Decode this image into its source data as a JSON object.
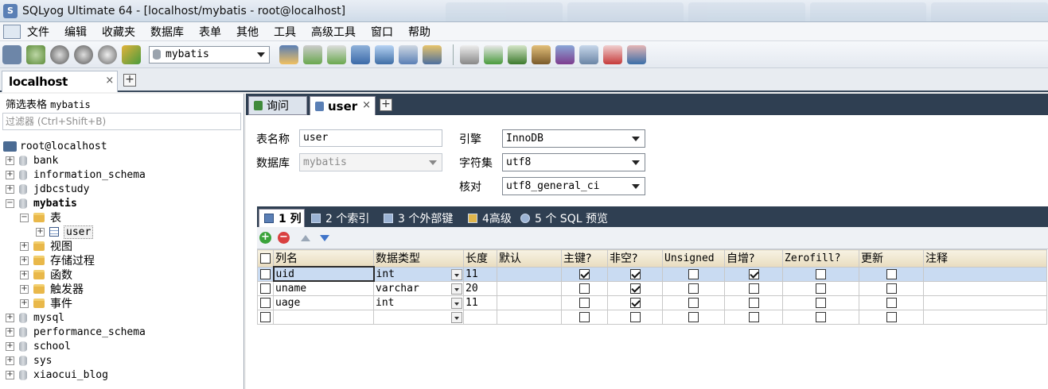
{
  "window": {
    "title": "SQLyog Ultimate 64 - [localhost/mybatis - root@localhost]"
  },
  "menu": [
    "文件",
    "编辑",
    "收藏夹",
    "数据库",
    "表单",
    "其他",
    "工具",
    "高级工具",
    "窗口",
    "帮助"
  ],
  "toolbar": {
    "database_select": "mybatis"
  },
  "connection_tab": {
    "label": "localhost",
    "close": "×"
  },
  "sidebar": {
    "filter_label": "筛选表格",
    "filter_db": "mybatis",
    "filter_placeholder": "过滤器 (Ctrl+Shift+B)",
    "root": "root@localhost",
    "databases": [
      "bank",
      "information_schema",
      "jdbcstudy",
      "mybatis",
      "mysql",
      "performance_schema",
      "school",
      "sys",
      "xiaocui_blog"
    ],
    "mybatis_children": {
      "tables": "表",
      "table_user": "user",
      "views": "视图",
      "procedures": "存储过程",
      "functions": "函数",
      "triggers": "触发器",
      "events": "事件"
    }
  },
  "query_tabs": [
    {
      "label": "询问"
    },
    {
      "label": "user",
      "close": "×"
    }
  ],
  "form": {
    "table_name_label": "表名称",
    "table_name": "user",
    "database_label": "数据库",
    "database": "mybatis",
    "engine_label": "引擎",
    "engine": "InnoDB",
    "charset_label": "字符集",
    "charset": "utf8",
    "collation_label": "核对",
    "collation": "utf8_general_ci"
  },
  "sub_tabs": [
    "1 列",
    "2 个索引",
    "3 个外部键",
    "4高级",
    "5 个 SQL 预览"
  ],
  "columns_grid": {
    "headers": [
      "列名",
      "数据类型",
      "长度",
      "默认",
      "主键?",
      "非空?",
      "Unsigned",
      "自增?",
      "Zerofill?",
      "更新",
      "注释"
    ],
    "rows": [
      {
        "name": "uid",
        "type": "int",
        "length": "11",
        "pk": true,
        "notnull": true,
        "unsigned": false,
        "autoinc": true,
        "zerofill": false,
        "update": false
      },
      {
        "name": "uname",
        "type": "varchar",
        "length": "20",
        "pk": false,
        "notnull": true,
        "unsigned": false,
        "autoinc": false,
        "zerofill": false,
        "update": false
      },
      {
        "name": "uage",
        "type": "int",
        "length": "11",
        "pk": false,
        "notnull": true,
        "unsigned": false,
        "autoinc": false,
        "zerofill": false,
        "update": false
      },
      {
        "name": "",
        "type": "",
        "length": "",
        "pk": false,
        "notnull": false,
        "unsigned": false,
        "autoinc": false,
        "zerofill": false,
        "update": false
      }
    ]
  }
}
